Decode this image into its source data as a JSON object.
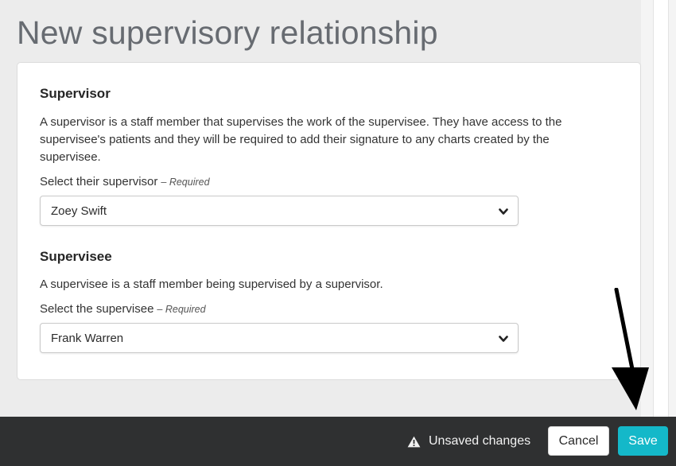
{
  "page": {
    "title": "New supervisory relationship"
  },
  "supervisor": {
    "heading": "Supervisor",
    "description": "A supervisor is a staff member that supervises the work of the supervisee. They have access to the supervisee's patients and they will be required to add their signature to any charts created by the supervisee.",
    "field_label": "Select their supervisor",
    "required_label": "– Required",
    "selected_value": "Zoey Swift"
  },
  "supervisee": {
    "heading": "Supervisee",
    "description": "A supervisee is a staff member being supervised by a supervisor.",
    "field_label": "Select the supervisee",
    "required_label": "– Required",
    "selected_value": "Frank Warren"
  },
  "footer": {
    "unsaved_text": "Unsaved changes",
    "cancel_label": "Cancel",
    "save_label": "Save"
  },
  "colors": {
    "accent": "#14b8c9",
    "footer_bg": "#2f3031",
    "page_bg": "#ececec"
  },
  "icons": {
    "warning": "warning-icon",
    "chevron": "chevron-down-icon",
    "annotation": "arrow-annotation"
  }
}
